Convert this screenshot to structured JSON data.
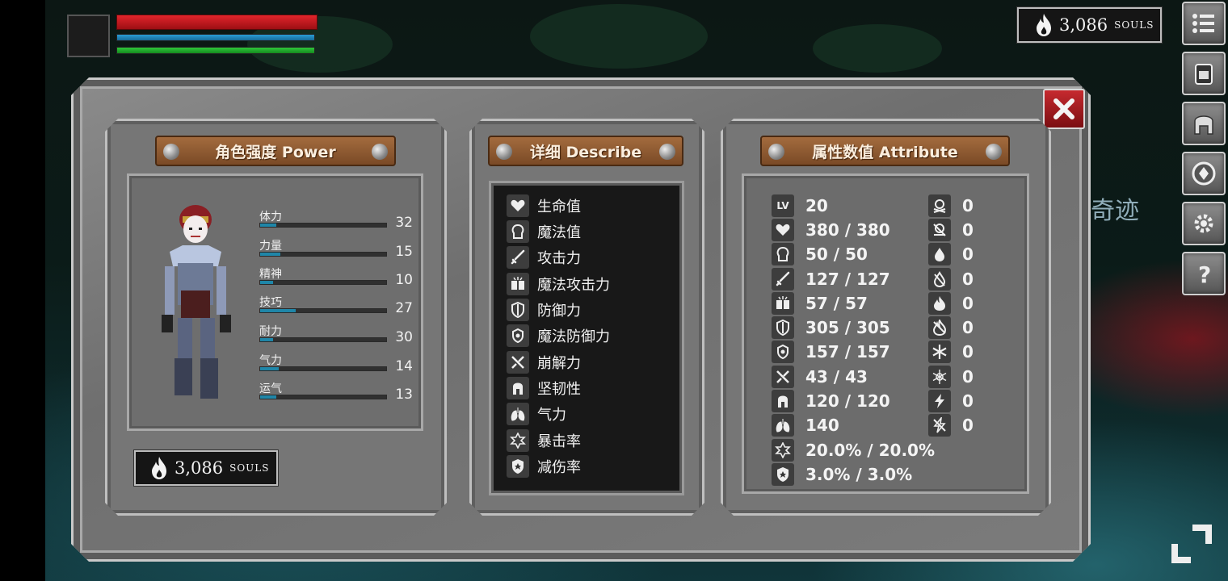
{
  "hud": {
    "souls_value": "3,086",
    "souls_label": "SOULS"
  },
  "background": {
    "sign_text": "奇迹"
  },
  "side_menu": [
    "menu-icon",
    "backpack-icon",
    "helmet-icon",
    "emblem-icon",
    "gear-icon",
    "help-icon"
  ],
  "power_panel": {
    "title": "角色强度 Power",
    "stats": [
      {
        "name": "体力",
        "value": 32,
        "fill": 0.13
      },
      {
        "name": "力量",
        "value": 15,
        "fill": 0.16
      },
      {
        "name": "精神",
        "value": 10,
        "fill": 0.1
      },
      {
        "name": "技巧",
        "value": 27,
        "fill": 0.28
      },
      {
        "name": "耐力",
        "value": 30,
        "fill": 0.1
      },
      {
        "name": "气力",
        "value": 14,
        "fill": 0.15
      },
      {
        "name": "运气",
        "value": 13,
        "fill": 0.13
      }
    ],
    "souls_value": "3,086",
    "souls_label": "SOULS"
  },
  "describe_panel": {
    "title": "详细 Describe",
    "items": [
      {
        "label": "生命值",
        "icon": "heart-icon"
      },
      {
        "label": "魔法值",
        "icon": "head-icon"
      },
      {
        "label": "攻击力",
        "icon": "sword-icon"
      },
      {
        "label": "魔法攻击力",
        "icon": "spellbook-icon"
      },
      {
        "label": "防御力",
        "icon": "shield-icon"
      },
      {
        "label": "魔法防御力",
        "icon": "magic-shield-icon"
      },
      {
        "label": "崩解力",
        "icon": "poise-break-icon"
      },
      {
        "label": "坚韧性",
        "icon": "helmet-icon"
      },
      {
        "label": "气力",
        "icon": "lungs-icon"
      },
      {
        "label": "暴击率",
        "icon": "critical-icon"
      },
      {
        "label": "减伤率",
        "icon": "damage-reduction-icon"
      }
    ]
  },
  "attribute_panel": {
    "title": "属性数值 Attribute",
    "lv_label": "LV",
    "left_values": [
      "20",
      "380 / 380",
      "50 / 50",
      "127 / 127",
      "57 / 57",
      "305 / 305",
      "157 / 157",
      "43 / 43",
      "120 / 120",
      "140",
      "20.0% / 20.0%",
      "3.0% / 3.0%"
    ],
    "right_values": [
      "0",
      "0",
      "0",
      "0",
      "0",
      "0",
      "0",
      "0",
      "0",
      "0"
    ],
    "right_icons": [
      "poison-icon",
      "toxic-icon",
      "bleed-icon",
      "bleed-resist-icon",
      "fire-icon",
      "fire-resist-icon",
      "frost-icon",
      "frost-resist-icon",
      "lightning-icon",
      "lightning-resist-icon"
    ]
  },
  "colors": {
    "stat_fill": "#1f86a8",
    "hp": "#e2252b",
    "mp": "#2a9cd4",
    "stamina": "#2ec83a",
    "close": "#c62a2f",
    "plank": "#a36b3e"
  }
}
